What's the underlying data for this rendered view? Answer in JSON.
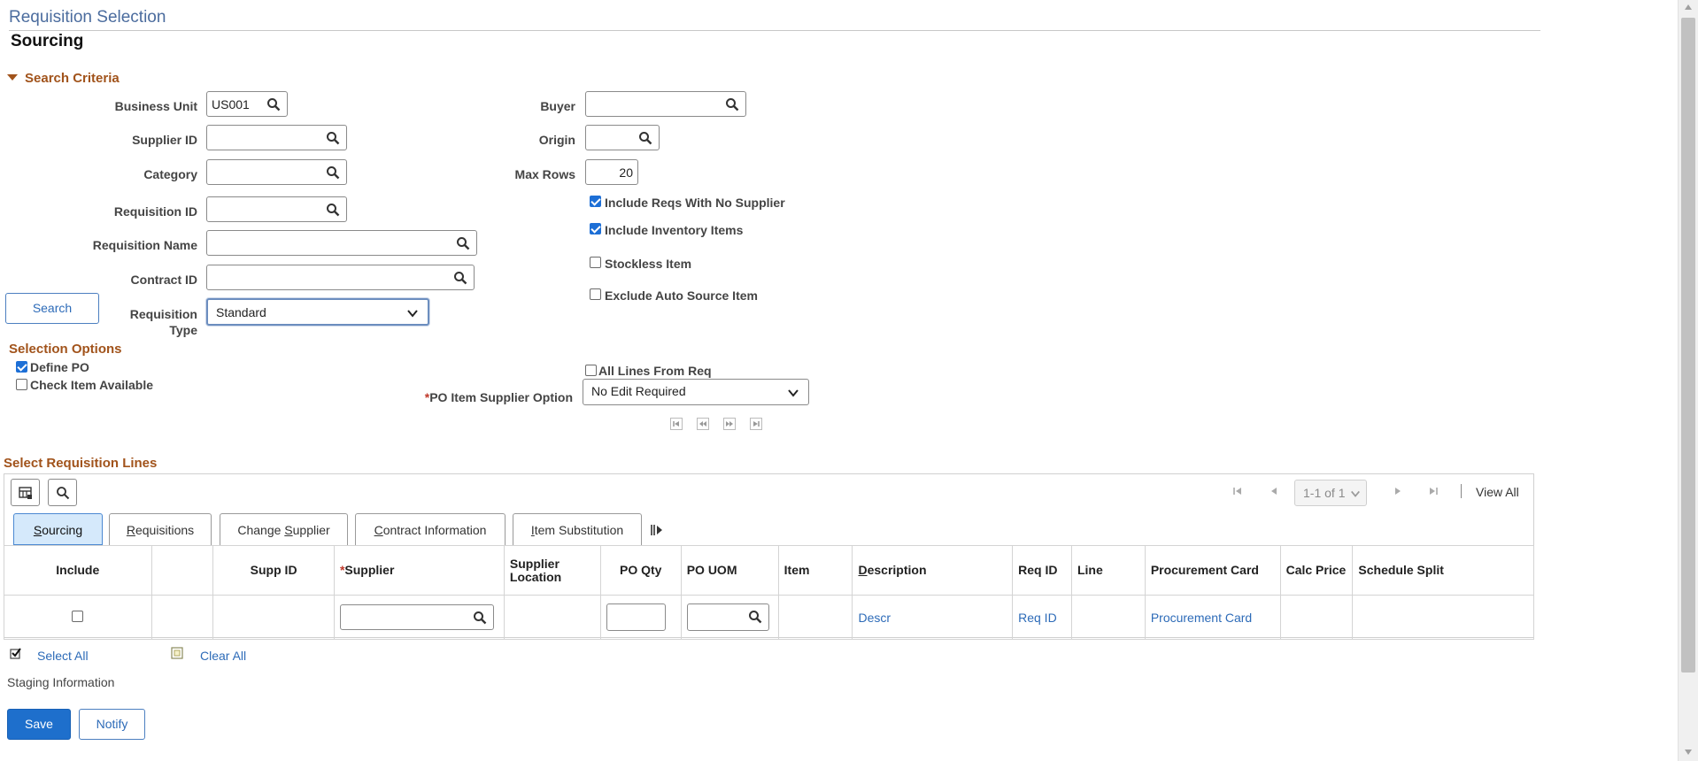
{
  "header": {
    "title": "Requisition Selection",
    "subtitle": "Sourcing"
  },
  "search_criteria": {
    "heading": "Search Criteria",
    "business_unit": {
      "label": "Business Unit",
      "value": "US001"
    },
    "supplier_id": {
      "label": "Supplier ID",
      "value": ""
    },
    "category": {
      "label": "Category",
      "value": ""
    },
    "requisition_id": {
      "label": "Requisition ID",
      "value": ""
    },
    "requisition_name": {
      "label": "Requisition Name",
      "value": ""
    },
    "contract_id": {
      "label": "Contract ID",
      "value": ""
    },
    "requisition_type": {
      "label": "Requisition Type",
      "value": "Standard"
    },
    "buyer": {
      "label": "Buyer",
      "value": ""
    },
    "origin": {
      "label": "Origin",
      "value": ""
    },
    "max_rows": {
      "label": "Max Rows",
      "value": "20"
    },
    "include_reqs_no_supplier": {
      "label": "Include Reqs With No Supplier",
      "checked": true
    },
    "include_inventory_items": {
      "label": "Include Inventory Items",
      "checked": true
    },
    "stockless_item": {
      "label": "Stockless Item",
      "checked": false
    },
    "exclude_auto_source": {
      "label": "Exclude Auto Source Item",
      "checked": false
    },
    "search_button": "Search"
  },
  "selection_options": {
    "heading": "Selection Options",
    "define_po": {
      "label": "Define PO",
      "checked": true
    },
    "check_item_available": {
      "label": "Check Item Available",
      "checked": false
    },
    "all_lines_from_req": {
      "label": "All Lines From Req",
      "checked": false
    },
    "po_item_supplier_option": {
      "label": "PO Item Supplier Option",
      "required_mark": "*",
      "value": "No Edit Required"
    }
  },
  "lines": {
    "heading": "Select Requisition Lines",
    "pager": {
      "range": "1-1 of 1",
      "view_all": "View All"
    },
    "tabs": [
      {
        "key": "S",
        "rest": "ourcing",
        "label": "Sourcing",
        "active": true
      },
      {
        "key": "R",
        "rest": "equisitions",
        "label": "Requisitions"
      },
      {
        "pre": "Change ",
        "key": "S",
        "rest": "upplier",
        "label": "Change Supplier"
      },
      {
        "key": "C",
        "rest": "ontract Information",
        "label": "Contract Information"
      },
      {
        "key": "I",
        "rest": "tem Substitution",
        "label": "Item Substitution"
      }
    ],
    "columns": {
      "include": "Include",
      "blank": "",
      "supp_id": "Supp ID",
      "supplier_req": "*",
      "supplier": "Supplier",
      "supplier_location": "Supplier Location",
      "po_qty": "PO Qty",
      "po_uom": "PO UOM",
      "item": "Item",
      "description": "Description",
      "req_id": "Req ID",
      "line": "Line",
      "procurement_card": "Procurement Card",
      "calc_price": "Calc Price",
      "schedule_split": "Schedule Split"
    },
    "row": {
      "include": false,
      "descr": "Descr",
      "req_id": "Req ID",
      "procurement_card": "Procurement Card"
    },
    "select_all": "Select All",
    "clear_all": "Clear All"
  },
  "staging": {
    "label": "Staging Information"
  },
  "footer": {
    "save": "Save",
    "notify": "Notify"
  },
  "colors": {
    "section": "#a1531b",
    "link": "#2d6bb8",
    "primary": "#1e6fcc",
    "title": "#4b6c9e"
  },
  "icons": [
    "search-icon",
    "chevron-down-icon",
    "grid-personalize-icon",
    "first-page-icon",
    "previous-page-icon",
    "next-page-icon",
    "last-page-icon",
    "show-all-columns-icon"
  ]
}
